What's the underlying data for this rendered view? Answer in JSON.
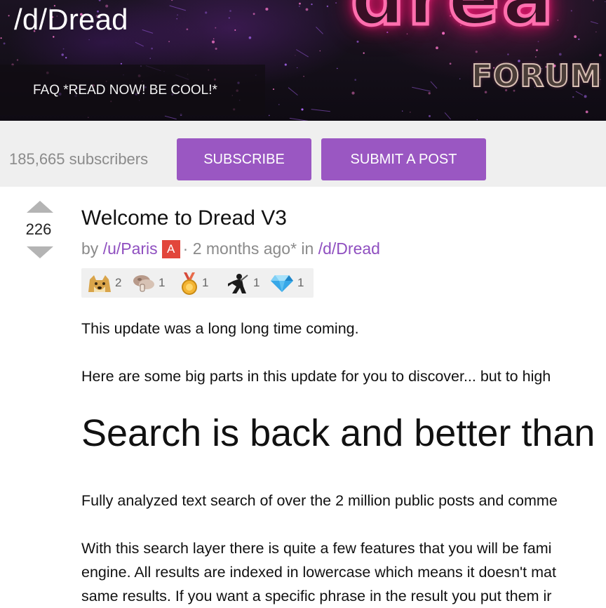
{
  "banner": {
    "subreddit_title": "/d/Dread",
    "logo_text": "drea",
    "logo_subtext": "FORUM",
    "faq_link": "FAQ *READ NOW! BE COOL!*"
  },
  "sub_bar": {
    "subscriber_count": "185,665 subscribers",
    "subscribe_label": "SUBSCRIBE",
    "submit_label": "SUBMIT A POST"
  },
  "post": {
    "score": "226",
    "title": "Welcome to Dread V3",
    "meta": {
      "by": "by",
      "author": "/u/Paris",
      "badge": "A",
      "time": "· 2 months ago* in",
      "subreddit": "/d/Dread"
    },
    "awards": [
      {
        "icon": "doge-icon",
        "count": "2"
      },
      {
        "icon": "mushroom-icon",
        "count": "1"
      },
      {
        "icon": "gold-medal-icon",
        "count": "1"
      },
      {
        "icon": "ninja-icon",
        "count": "1"
      },
      {
        "icon": "diamond-icon",
        "count": "1"
      }
    ],
    "body": {
      "p1": "This update was a long long time coming.",
      "p2": "Here are some big parts in this update for you to discover... but to high",
      "heading": "Search is back and better than",
      "p3": "Fully analyzed text search of over the 2 million public posts and comme",
      "p4_line1": "With this search layer there is quite a few features that you will be fami",
      "p4_line2": "engine. All results are indexed in lowercase which means it doesn't mat",
      "p4_line3": "same results. If you want a specific phrase in the result you put them ir"
    }
  },
  "colors": {
    "accent_purple": "#9a57c2",
    "link_purple": "#8f4fc0",
    "admin_badge_red": "#e2463b",
    "banner_dark": "#140f19",
    "subbar_gray": "#efefef"
  }
}
